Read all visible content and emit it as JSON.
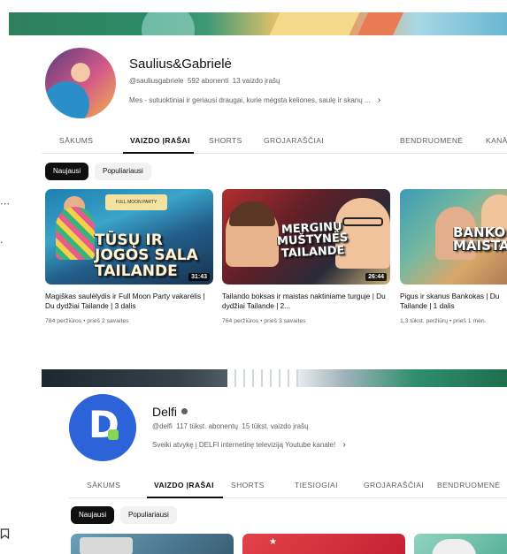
{
  "side": {
    "more_glyph": "⋯",
    "divider_glyph": "·"
  },
  "channel1": {
    "name": "Saulius&Gabrielė",
    "handle": "@sauliusgabriele",
    "subscribers": "592 abonenti",
    "videos_count": "13 vaizdo įrašų",
    "description": "Mes - sutuoktiniai ir geriausi draugai, kurie mėgsta keliones, saulę ir skanų ...",
    "desc_chevron": "›",
    "tabs": [
      "SĀKUMS",
      "VAIZDO ĮRAŠAI",
      "SHORTS",
      "GROJARAŠČIAI",
      "BENDRUOMENĖ",
      "KANĀ"
    ],
    "active_tab_index": 1,
    "chips": [
      "Naujausi",
      "Populiariausi"
    ],
    "videos": [
      {
        "overlay_text": "TŪSŲ IR JOGOS SALA TAILANDE",
        "overlay_sign": "FULL MOON PARTY",
        "duration": "31:43",
        "title": "Magiškas saulėlydis ir Full Moon Party vakarėlis | Du dydžiai Tailande | 3 dalis",
        "meta": "784 peržiūros • prieš 2 savaites"
      },
      {
        "overlay_text": "MERGINŲ MUŠTYNĖS TAILANDE",
        "duration": "26:44",
        "title": "Tailando boksas ir maistas naktiniame turguje | Du dydžiai Tailande | 2...",
        "meta": "764 peržiūros • prieš 3 savaites"
      },
      {
        "overlay_text": "BANKO MAISTAS",
        "duration": "",
        "title": "Pigus ir skanus Bankokas | Du Tailande | 1 dalis",
        "meta": "1,3 tūkst. peržiūrų • prieš 1 mėn."
      }
    ]
  },
  "channel2": {
    "name": "Delfi",
    "handle": "@delfi",
    "subscribers": "117 tūkst. abonentų",
    "videos_count": "15 tūkst. vaizdo įrašų",
    "description": "Sveiki atvykę į DELFI internetinę televiziją Youtube kanale!",
    "desc_chevron": "›",
    "avatar_letter": "D",
    "tabs": [
      "SĀKUMS",
      "VAIZDO ĮRAŠAI",
      "SHORTS",
      "TIESIOGIAI",
      "GROJARAŠČIAI",
      "BENDRUOMENĖ"
    ],
    "active_tab_index": 1,
    "chips": [
      "Naujausi",
      "Populiariausi"
    ]
  },
  "colors": {
    "accent_dark": "#0f0f0f",
    "muted_text": "#606060",
    "delfi_blue": "#2d63d8",
    "delfi_green": "#8bd45a"
  }
}
